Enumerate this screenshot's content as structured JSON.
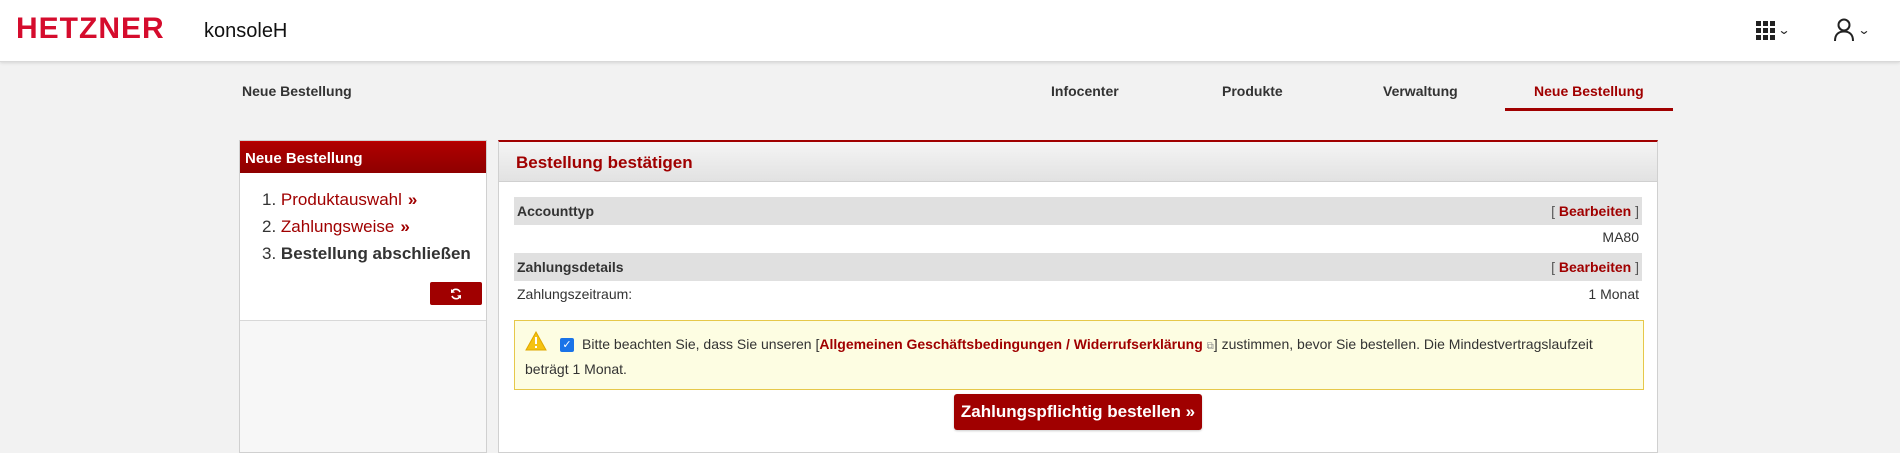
{
  "header": {
    "logo": "HETZNER",
    "app_name": "konsoleH",
    "apps_icon": "apps-grid-icon",
    "user_icon": "user-icon"
  },
  "nav": {
    "page_label": "Neue Bestellung",
    "tabs": [
      {
        "label": "Infocenter"
      },
      {
        "label": "Produkte"
      },
      {
        "label": "Verwaltung"
      },
      {
        "label": "Neue Bestellung",
        "active": true
      }
    ]
  },
  "sidebar": {
    "title": "Neue Bestellung",
    "steps": [
      {
        "number": "1.",
        "label": "Produktauswahl",
        "suffix": "»"
      },
      {
        "number": "2.",
        "label": "Zahlungsweise",
        "suffix": "»"
      },
      {
        "number": "3.",
        "label": "Bestellung abschließen"
      }
    ],
    "refresh_icon": "refresh-icon"
  },
  "main": {
    "title": "Bestellung bestätigen",
    "sections": [
      {
        "heading": "Accounttyp",
        "edit_label": "Bearbeiten",
        "value_right": "MA80"
      },
      {
        "heading": "Zahlungsdetails",
        "edit_label": "Bearbeiten",
        "value_left": "Zahlungszeitraum:",
        "value_right": "1 Monat"
      }
    ],
    "notice": {
      "checked": true,
      "text_before": "Bitte beachten Sie, dass Sie unseren [",
      "link_text": "Allgemeinen Geschäftsbedingungen / Widerrufserklärung",
      "text_after": "] zustimmen, bevor Sie bestellen. Die Mindestvertragslaufzeit beträgt 1 Monat."
    },
    "order_button": "Zahlungspflichtig bestellen »"
  },
  "colors": {
    "brand_red": "#d50c2d",
    "accent": "#a00000",
    "notice_bg": "#fdfde2",
    "notice_border": "#e6c84a"
  }
}
